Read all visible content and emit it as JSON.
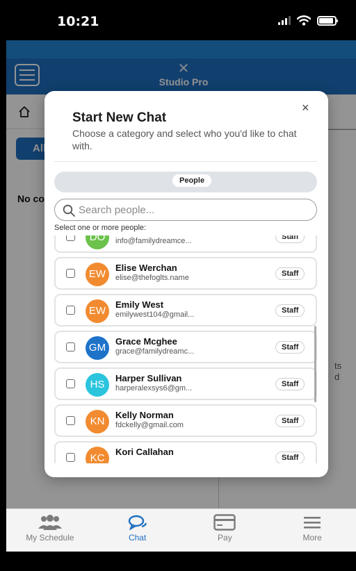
{
  "status": {
    "time": "10:21"
  },
  "app": {
    "logo_text": "Studio Pro"
  },
  "background": {
    "all_tab": "All",
    "no_conversations": "No co",
    "right_text_1": "ts",
    "right_text_2": "d"
  },
  "tabs": [
    {
      "label": "My Schedule",
      "icon": "people-icon"
    },
    {
      "label": "Chat",
      "icon": "chat-icon"
    },
    {
      "label": "Pay",
      "icon": "card-icon"
    },
    {
      "label": "More",
      "icon": "menu-icon"
    }
  ],
  "modal": {
    "close": "×",
    "title": "Start New Chat",
    "subtitle": "Choose a category and select who you'd like to chat with.",
    "segment_label": "People",
    "search_placeholder": "Search people...",
    "select_label": "Select one or more people:",
    "people": [
      {
        "initials": "DO",
        "name": "",
        "email": "info@familydreamce...",
        "role": "Staff",
        "color": "#6cc24a"
      },
      {
        "initials": "EW",
        "name": "Elise Werchan",
        "email": "elise@thefoglts.name",
        "role": "Staff",
        "color": "#f28b30"
      },
      {
        "initials": "EW",
        "name": "Emily West",
        "email": "emilywest104@gmail...",
        "role": "Staff",
        "color": "#f28b30"
      },
      {
        "initials": "GM",
        "name": "Grace Mcghee",
        "email": "grace@familydreamc...",
        "role": "Staff",
        "color": "#1e73c9"
      },
      {
        "initials": "HS",
        "name": "Harper Sullivan",
        "email": "harperalexsys6@gm...",
        "role": "Staff",
        "color": "#2bc4dd"
      },
      {
        "initials": "KN",
        "name": "Kelly Norman",
        "email": "fdckelly@gmail.com",
        "role": "Staff",
        "color": "#f28b30"
      },
      {
        "initials": "KC",
        "name": "Kori Callahan",
        "email": "",
        "role": "Staff",
        "color": "#f28b30"
      }
    ]
  }
}
